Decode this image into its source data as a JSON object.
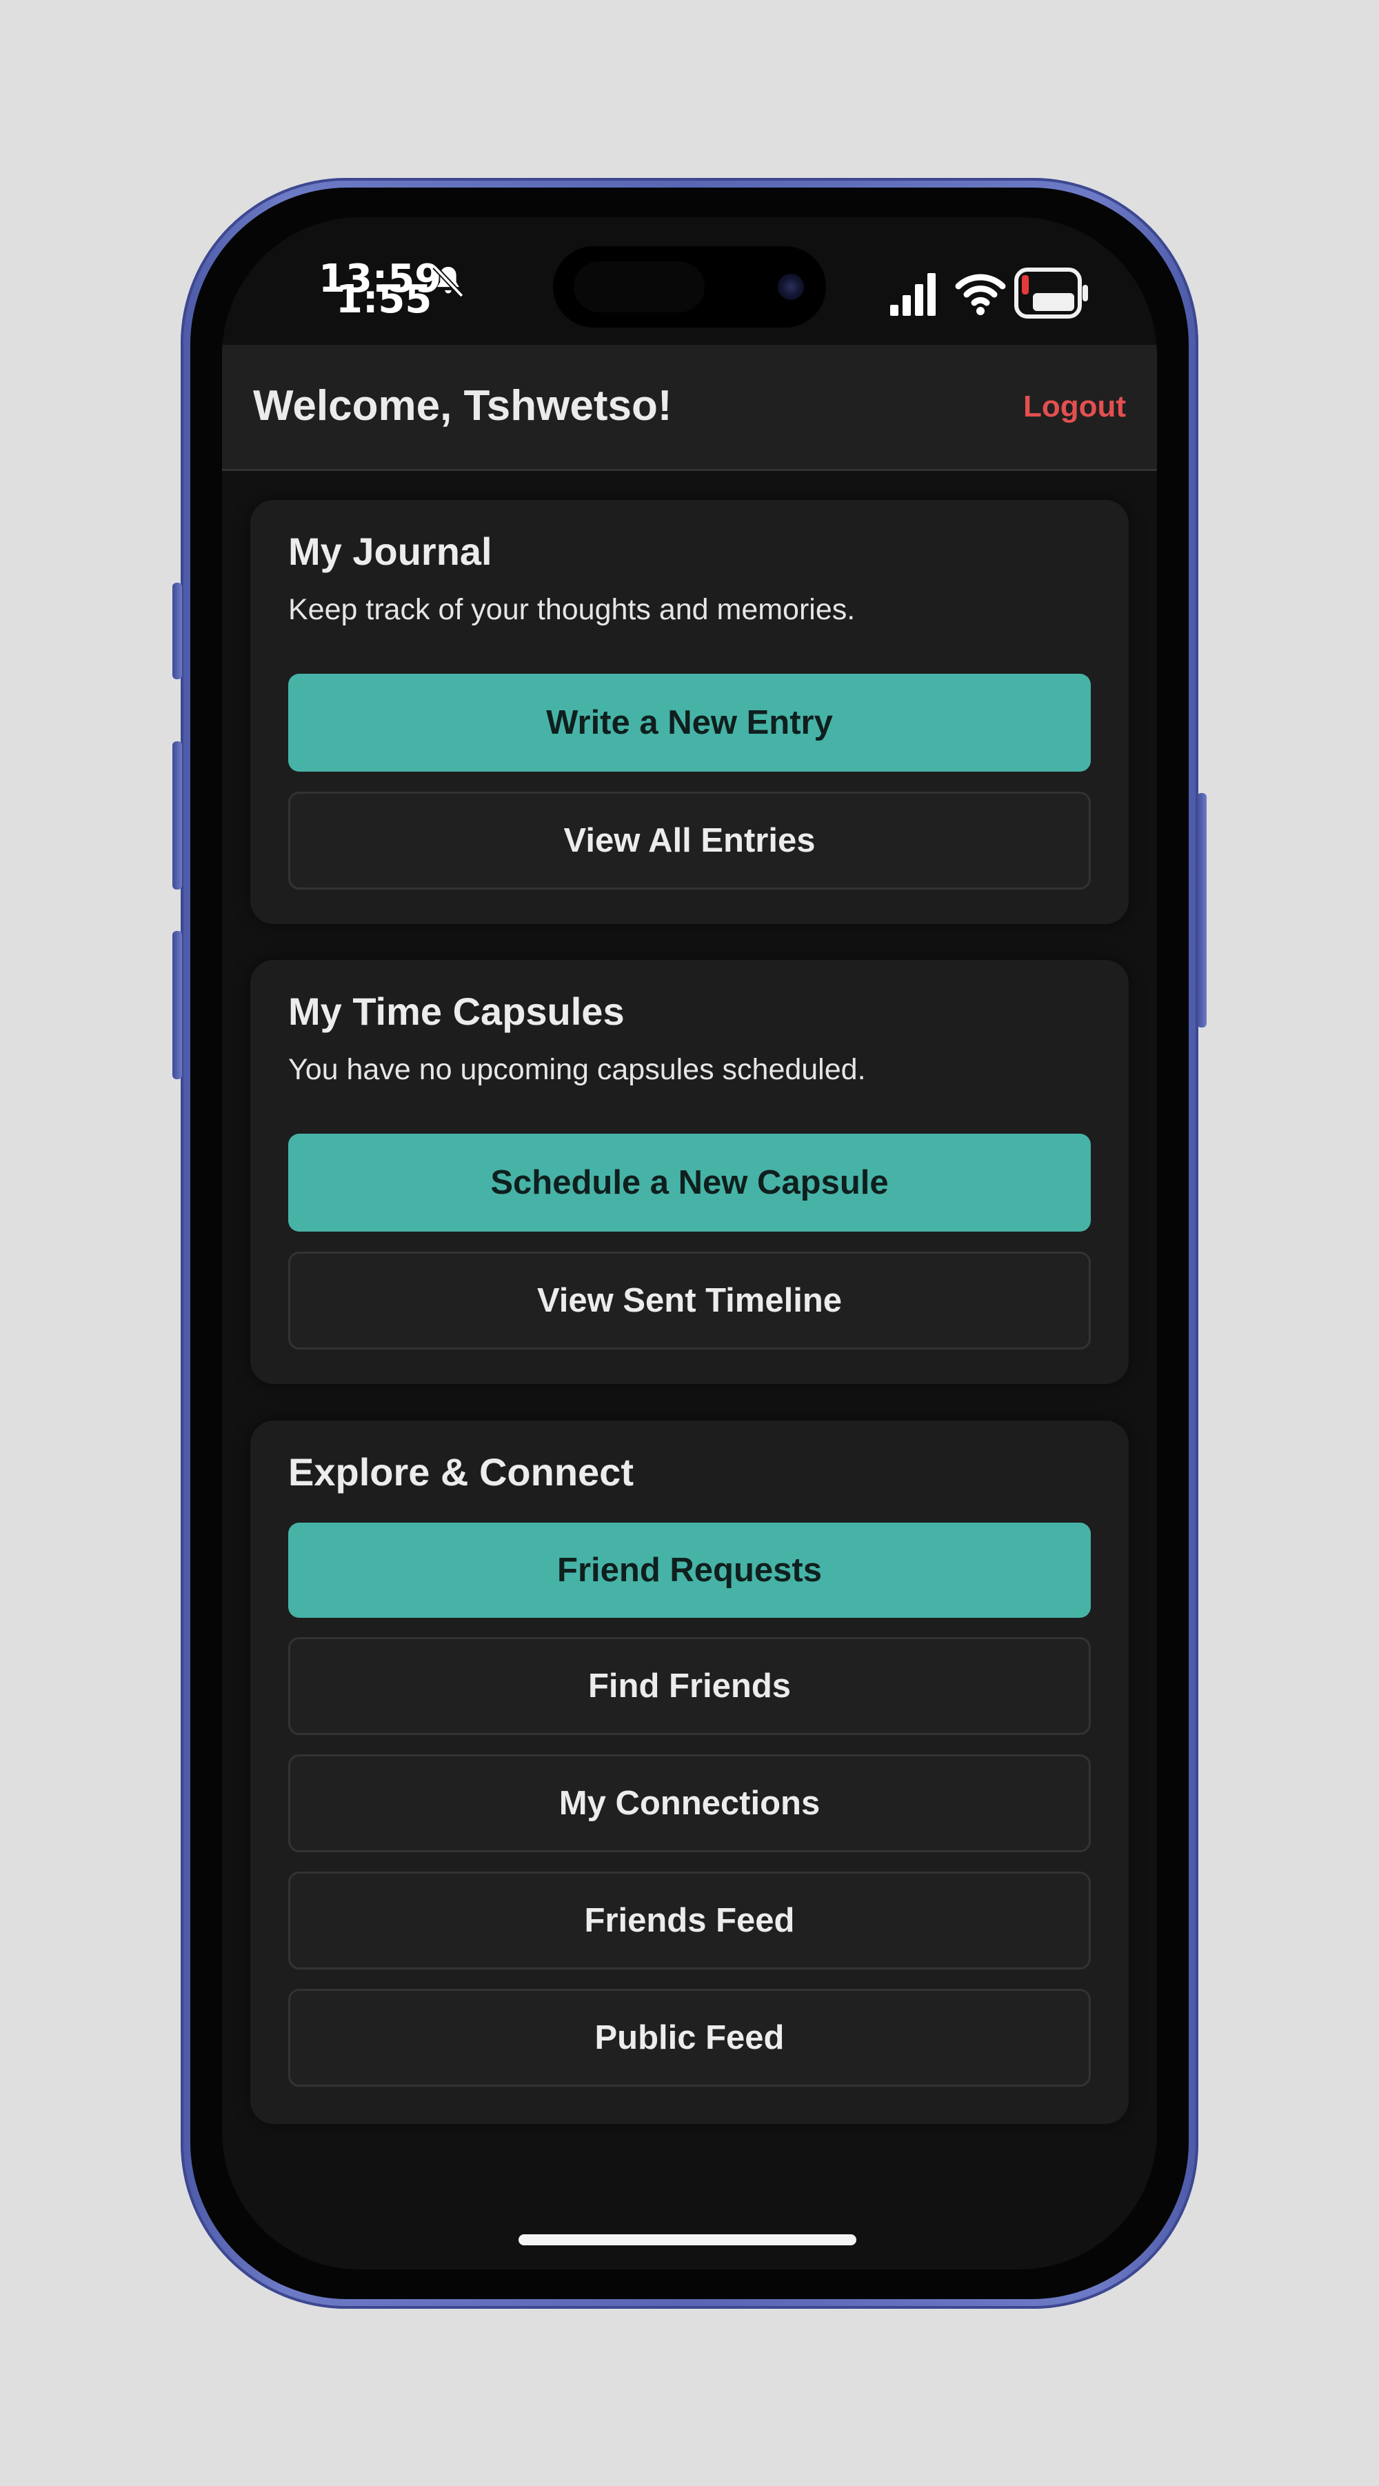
{
  "status_bar": {
    "time_primary": "13:59",
    "time_secondary": "1:55",
    "icons": [
      "bell-slash-icon",
      "cellular-signal-icon",
      "wifi-icon",
      "battery-low-icon"
    ]
  },
  "header": {
    "welcome": "Welcome, Tshwetso!",
    "logout_label": "Logout"
  },
  "journal": {
    "title": "My Journal",
    "subtitle": "Keep track of your thoughts and memories.",
    "primary_label": "Write a New Entry",
    "secondary_label": "View All Entries"
  },
  "capsules": {
    "title": "My Time Capsules",
    "subtitle": "You have no upcoming capsules scheduled.",
    "primary_label": "Schedule a New Capsule",
    "secondary_label": "View Sent Timeline"
  },
  "explore": {
    "title": "Explore & Connect",
    "buttons": [
      {
        "label": "Friend Requests"
      },
      {
        "label": "Find Friends"
      },
      {
        "label": "My Connections"
      },
      {
        "label": "Friends Feed"
      },
      {
        "label": "Public Feed"
      }
    ]
  },
  "colors": {
    "accent": "#47b3a7",
    "logout": "#e35050",
    "card_bg": "#1d1d1d",
    "screen_bg": "#111111",
    "phone_frame": "#5866b3"
  }
}
